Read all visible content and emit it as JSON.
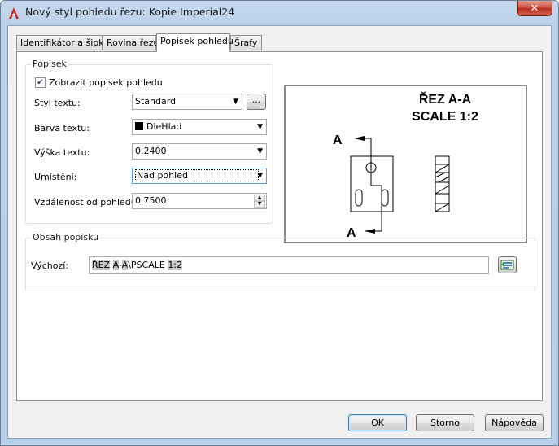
{
  "window": {
    "title": "Nový styl pohledu řezu: Kopie Imperial24",
    "close_symbol": "✕"
  },
  "tabs": [
    {
      "label": "Identifikátor a šipky"
    },
    {
      "label": "Rovina řezu"
    },
    {
      "label": "Popisek pohledu"
    },
    {
      "label": "Šrafy"
    }
  ],
  "popisek": {
    "group_label": "Popisek",
    "show_label": {
      "label": "Zobrazit popisek pohledu",
      "checked": true
    },
    "text_style": {
      "label": "Styl textu:",
      "value": "Standard",
      "browse_label": "..."
    },
    "text_color": {
      "label": "Barva textu:",
      "value": "DleHlad",
      "swatch": "#000000"
    },
    "text_height": {
      "label": "Výška textu:",
      "value": "0.2400"
    },
    "placement": {
      "label": "Umístění:",
      "value": "Nad pohled"
    },
    "offset": {
      "label": "Vzdálenost od pohledu:",
      "value": "0.7500"
    }
  },
  "preview": {
    "title_line1": "ŘEZ A-A",
    "title_line2": "SCALE 1:2",
    "section_letter_top": "A",
    "section_letter_bottom": "A"
  },
  "obsah": {
    "group_label": "Obsah popisku",
    "default_label": "Výchozí:",
    "parts": [
      {
        "text": "ŘEZ",
        "field": true
      },
      {
        "text": " ",
        "field": false
      },
      {
        "text": "A",
        "field": true
      },
      {
        "text": "-",
        "field": false
      },
      {
        "text": "A",
        "field": true
      },
      {
        "text": "\\PSCALE ",
        "field": false
      },
      {
        "text": "1:2",
        "field": true
      }
    ]
  },
  "buttons": {
    "ok": "OK",
    "cancel": "Storno",
    "help": "Nápověda"
  },
  "colors": {
    "accent": "#569de5",
    "app_icon_red": "#c62828"
  }
}
